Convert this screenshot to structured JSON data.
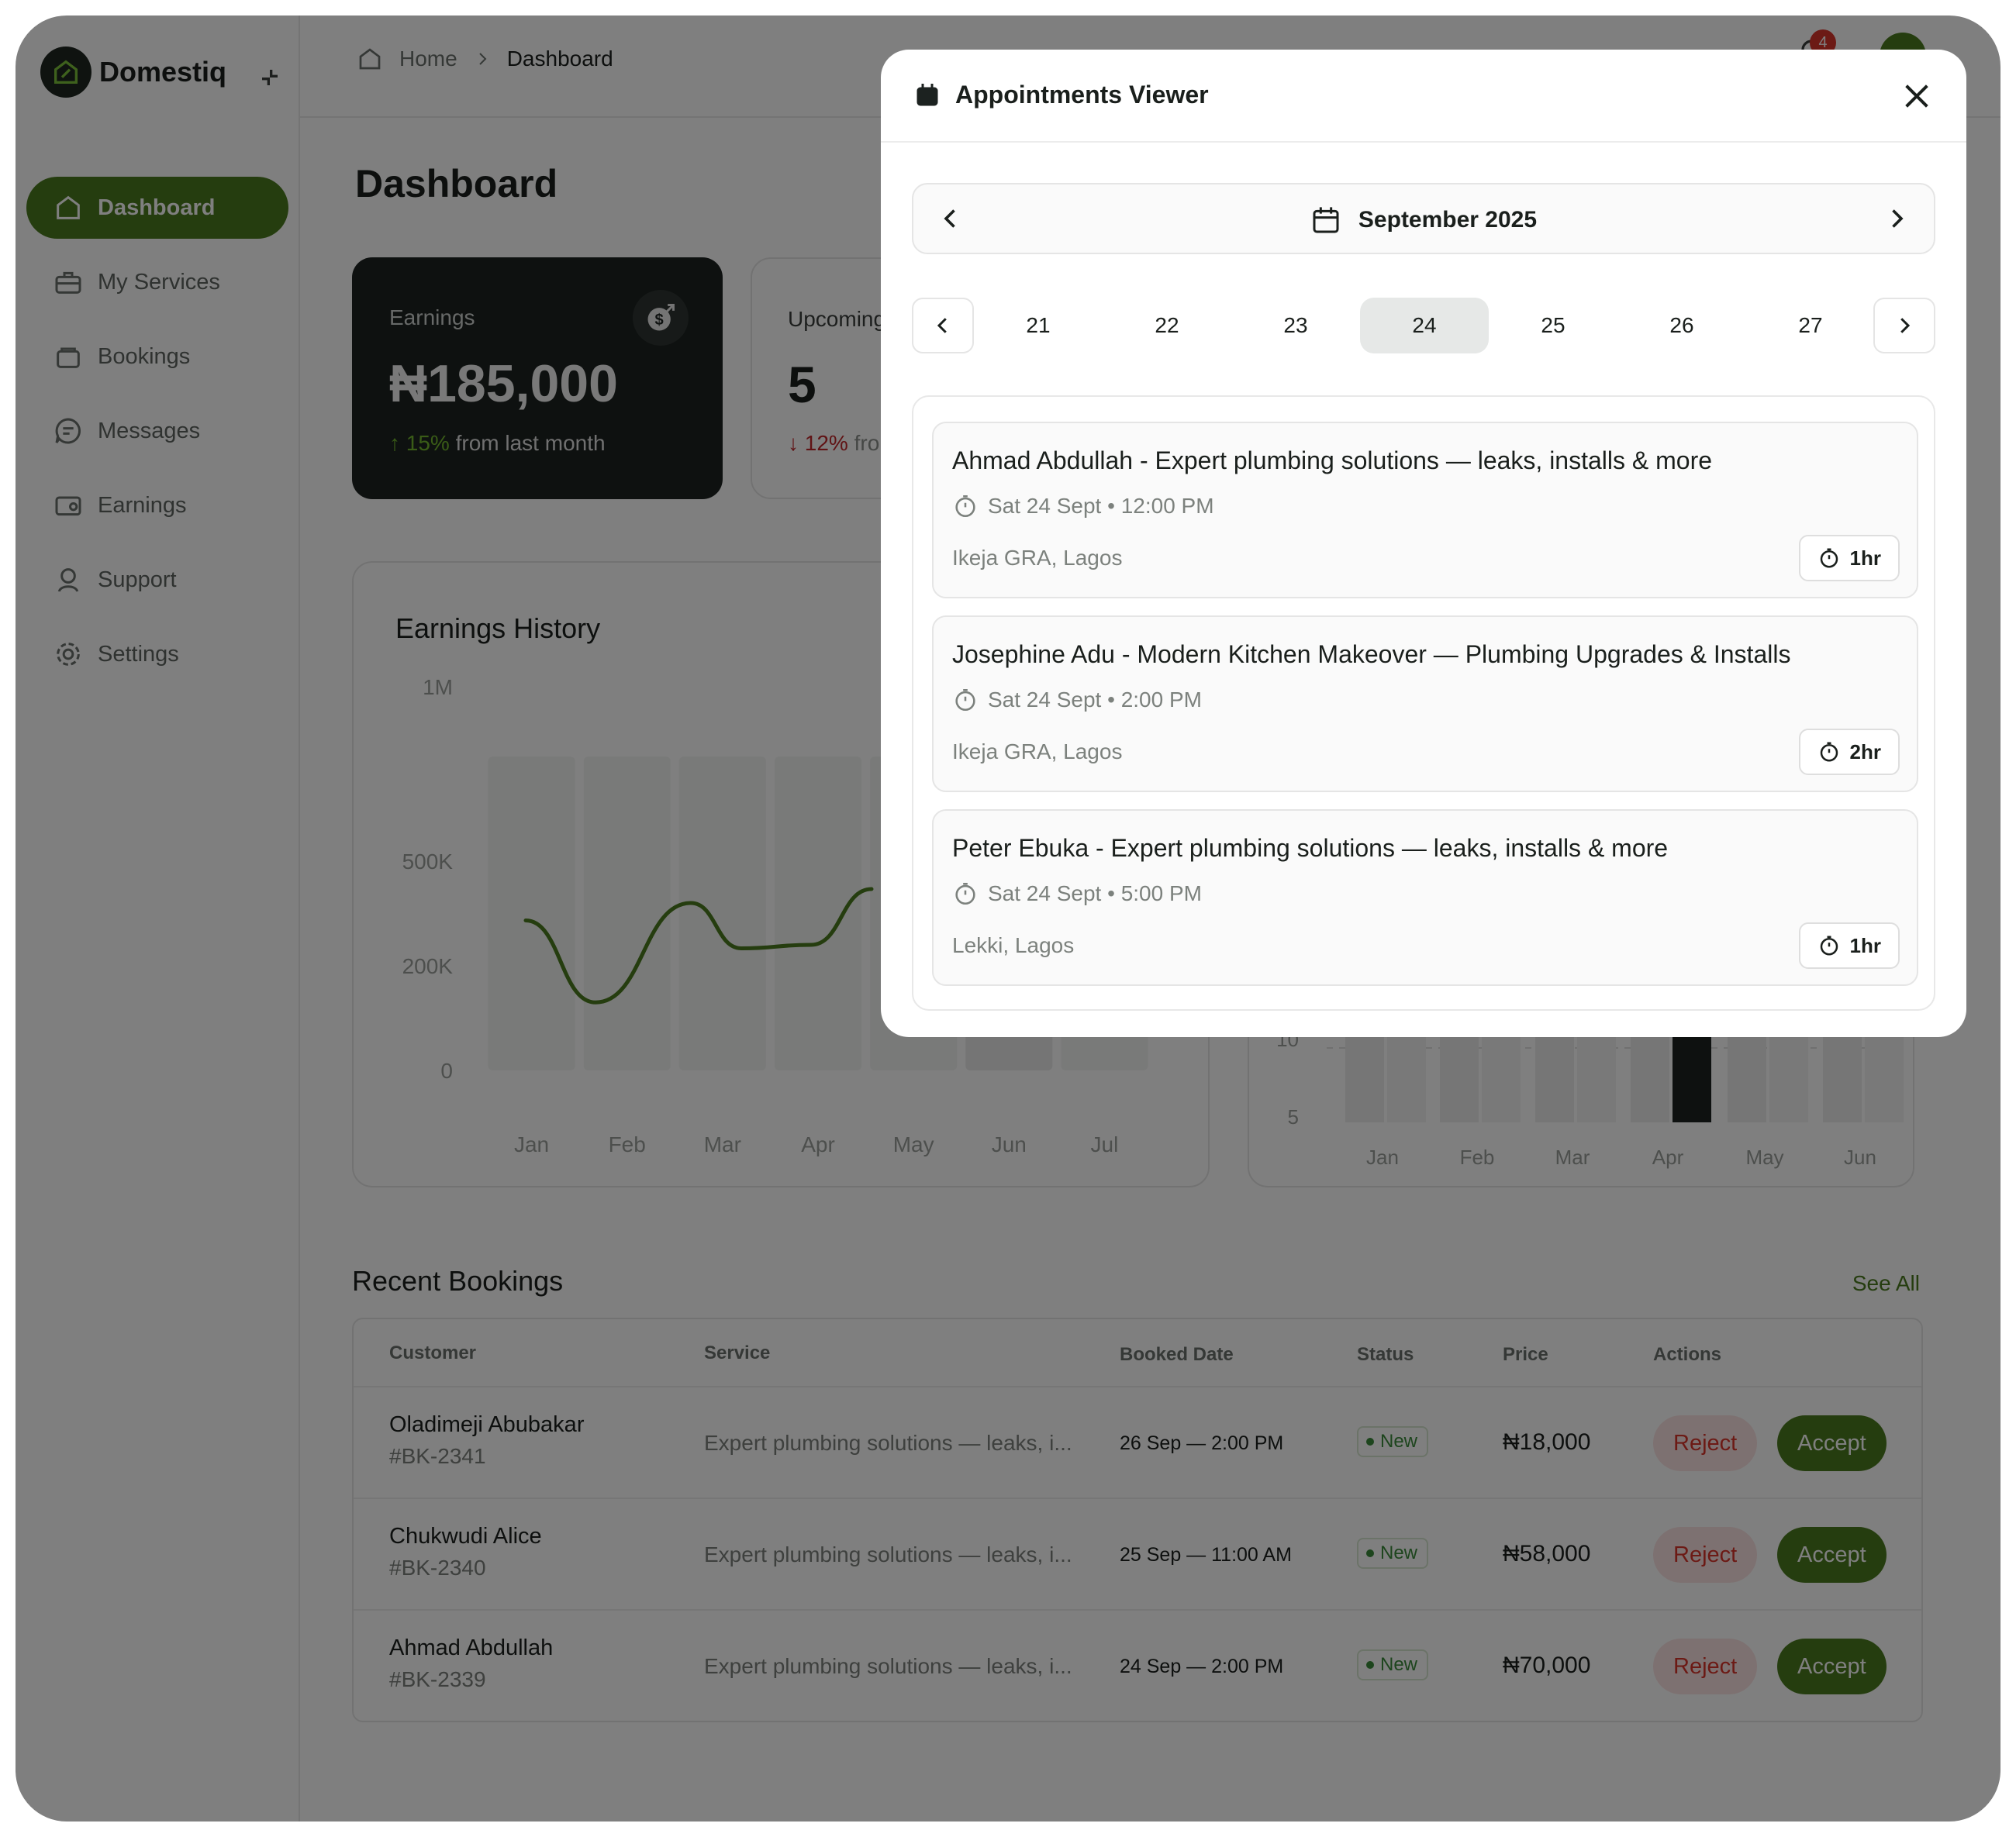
{
  "app": {
    "brand": "Domestiq"
  },
  "sidebar": {
    "items": [
      {
        "label": "Dashboard",
        "icon": "home-icon",
        "active": true
      },
      {
        "label": "My Services",
        "icon": "briefcase-icon"
      },
      {
        "label": "Bookings",
        "icon": "bag-icon"
      },
      {
        "label": "Messages",
        "icon": "message-icon"
      },
      {
        "label": "Earnings",
        "icon": "wallet-icon"
      },
      {
        "label": "Support",
        "icon": "support-icon"
      },
      {
        "label": "Settings",
        "icon": "gear-icon"
      }
    ]
  },
  "header": {
    "breadcrumb_home": "Home",
    "breadcrumb_current": "Dashboard",
    "notification_count": "4"
  },
  "page": {
    "title": "Dashboard"
  },
  "cards": {
    "earnings": {
      "label": "Earnings",
      "value": "₦185,000",
      "delta": "15%",
      "delta_text": "from last month"
    },
    "upcoming": {
      "label": "Upcoming",
      "value": "5",
      "delta": "12%",
      "delta_text": "fro"
    }
  },
  "earnings_history": {
    "title": "Earnings History"
  },
  "chart_data": [
    {
      "type": "line",
      "title": "Earnings History",
      "categories": [
        "Jan",
        "Feb",
        "Mar",
        "Apr",
        "May",
        "Jun",
        "Jul"
      ],
      "yticks": [
        "0",
        "200K",
        "500K",
        "1M"
      ],
      "points": [
        {
          "x": "Jan",
          "y": 330000
        },
        {
          "x": "Jan-Feb",
          "y": 130000
        },
        {
          "x": "Feb-Mar",
          "y": 380000
        },
        {
          "x": "Mar",
          "y": 250000
        },
        {
          "x": "Mar-Apr",
          "y": 260000
        },
        {
          "x": "Apr",
          "y": 420000
        }
      ],
      "line_color": "#4a7a1e"
    },
    {
      "type": "bar",
      "categories": [
        "Jan",
        "Feb",
        "Mar",
        "Apr",
        "May",
        "Jun"
      ],
      "yticks": [
        "5",
        "10"
      ],
      "highlight": "Apr",
      "bar_color": "#1c2220"
    }
  ],
  "recent_bookings": {
    "title": "Recent Bookings",
    "see_all": "See All",
    "columns": [
      "Customer",
      "Service",
      "Booked Date",
      "Status",
      "Price",
      "Actions"
    ],
    "rows": [
      {
        "name": "Oladimeji Abubakar",
        "id": "#BK-2341",
        "service": "Expert plumbing solutions — leaks, i...",
        "date": "26 Sep — 2:00 PM",
        "status": "New",
        "price": "₦18,000",
        "reject": "Reject",
        "accept": "Accept"
      },
      {
        "name": "Chukwudi Alice",
        "id": "#BK-2340",
        "service": "Expert plumbing solutions — leaks, i...",
        "date": "25 Sep — 11:00 AM",
        "status": "New",
        "price": "₦58,000",
        "reject": "Reject",
        "accept": "Accept"
      },
      {
        "name": "Ahmad Abdullah",
        "id": "#BK-2339",
        "service": "Expert plumbing solutions — leaks, i...",
        "date": "24 Sep — 2:00 PM",
        "status": "New",
        "price": "₦70,000",
        "reject": "Reject",
        "accept": "Accept"
      }
    ]
  },
  "modal": {
    "title": "Appointments Viewer",
    "month": "September 2025",
    "days": [
      "21",
      "22",
      "23",
      "24",
      "25",
      "26",
      "27"
    ],
    "selected_day": "24",
    "appointments": [
      {
        "title": "Ahmad Abdullah - Expert plumbing solutions — leaks, installs & more",
        "time": "Sat 24 Sept • 12:00 PM",
        "location": "Ikeja GRA, Lagos",
        "duration": "1hr"
      },
      {
        "title": "Josephine Adu - Modern Kitchen Makeover — Plumbing Upgrades & Installs",
        "time": "Sat 24 Sept • 2:00 PM",
        "location": "Ikeja GRA, Lagos",
        "duration": "2hr"
      },
      {
        "title": "Peter Ebuka - Expert plumbing solutions — leaks, installs & more",
        "time": "Sat 24 Sept • 5:00 PM",
        "location": "Lekki, Lagos",
        "duration": "1hr"
      }
    ]
  },
  "colors": {
    "brand_green": "#4a7a1e",
    "dark_card": "#1c2220",
    "reject_red": "#d9342b"
  }
}
